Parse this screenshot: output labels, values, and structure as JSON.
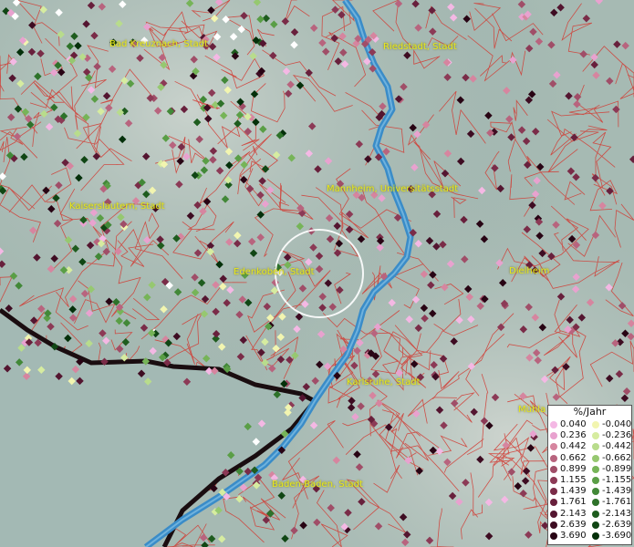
{
  "places": [
    {
      "name": "Bad Kreuznach, Stadt"
    },
    {
      "name": "Riedstadt, Stadt"
    },
    {
      "name": "Mannheim, Universitätsstadt"
    },
    {
      "name": "Kaiserslautern, Stadt"
    },
    {
      "name": "Edenkoben, Stadt"
    },
    {
      "name": "Dielheim"
    },
    {
      "name": "Karlsruhe, Stadt"
    },
    {
      "name": "Mühla"
    },
    {
      "name": "Baden-Baden, Stadt"
    }
  ],
  "legend": {
    "title": "%/Jahr",
    "positive": [
      {
        "label": "0.040",
        "color": "#f4b8e4"
      },
      {
        "label": "0.236",
        "color": "#e8a2cf"
      },
      {
        "label": "0.442",
        "color": "#d6859f"
      },
      {
        "label": "0.662",
        "color": "#b8647e"
      },
      {
        "label": "0.899",
        "color": "#a04e68"
      },
      {
        "label": "1.155",
        "color": "#8c3a56"
      },
      {
        "label": "1.439",
        "color": "#7a2c48"
      },
      {
        "label": "1.761",
        "color": "#68203c"
      },
      {
        "label": "2.143",
        "color": "#541530"
      },
      {
        "label": "2.639",
        "color": "#3e0c22"
      },
      {
        "label": "3.690",
        "color": "#280414"
      }
    ],
    "negative": [
      {
        "label": "-0.040",
        "color": "#f2f5b0"
      },
      {
        "label": "-0.236",
        "color": "#d6eca0"
      },
      {
        "label": "-0.442",
        "color": "#b8dc8c"
      },
      {
        "label": "-0.662",
        "color": "#96c870"
      },
      {
        "label": "-0.899",
        "color": "#76b458"
      },
      {
        "label": "-1.155",
        "color": "#5a9e46"
      },
      {
        "label": "-1.439",
        "color": "#428838"
      },
      {
        "label": "-1.761",
        "color": "#2e722a"
      },
      {
        "label": "-2.143",
        "color": "#1e5c1e"
      },
      {
        "label": "-2.639",
        "color": "#104614"
      },
      {
        "label": "-3.690",
        "color": "#04300a"
      }
    ]
  }
}
